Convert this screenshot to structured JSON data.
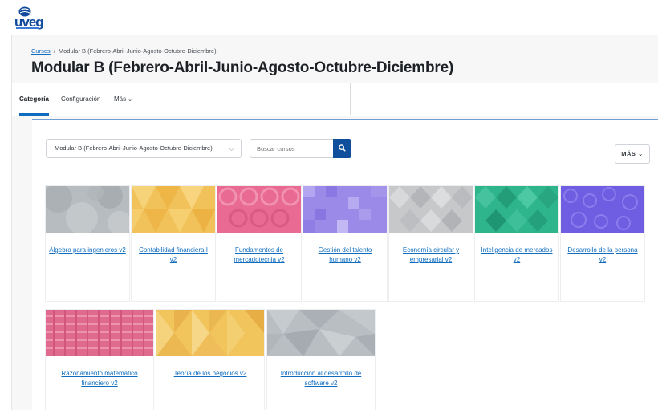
{
  "brand": {
    "logo_text": "uveg"
  },
  "breadcrumb": {
    "root": "Cursos",
    "current": "Modular B (Febrero-Abril-Junio-Agosto-Octubre-Diciembre)"
  },
  "page": {
    "title": "Modular B (Febrero-Abril-Junio-Agosto-Octubre-Diciembre)"
  },
  "tabs": [
    {
      "label": "Categoría",
      "active": true
    },
    {
      "label": "Configuración",
      "active": false
    },
    {
      "label": "Más",
      "active": false
    }
  ],
  "toolbar": {
    "category_value": "Modular B (Febrero-Abril-Junio-Agosto-Octubre-Diciembre)",
    "search_placeholder": "Buscar cursos",
    "more_label": "MÁS"
  },
  "courses": [
    {
      "name": "Álgebra para ingenieros v2",
      "color": "#b7bcc0"
    },
    {
      "name": "Contabilidad financiera I v2",
      "color": "#f2c25a"
    },
    {
      "name": "Fundamentos de mercadotecnia v2",
      "color": "#e96a92"
    },
    {
      "name": "Gestión del talento humano v2",
      "color": "#9c8ae8"
    },
    {
      "name": "Economía circular y empresarial v2",
      "color": "#c6c8ca"
    },
    {
      "name": "Inteligencia de mercados v2",
      "color": "#2fb58c"
    },
    {
      "name": "Desarrollo de la persona v2",
      "color": "#6f5ee2"
    },
    {
      "name": "Razonamiento matemático financiero v2",
      "color": "#e06a8e"
    },
    {
      "name": "Teoría de los negocios v2",
      "color": "#f1c45c"
    },
    {
      "name": "Introducción al desarrollo de software v2",
      "color": "#b8bec2"
    }
  ]
}
